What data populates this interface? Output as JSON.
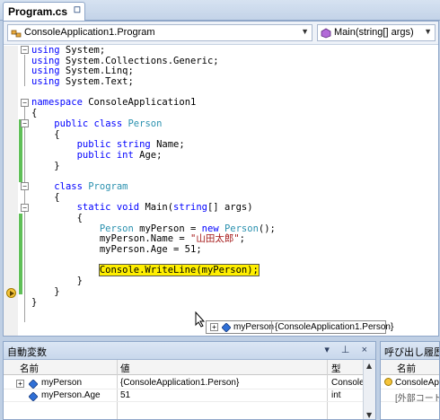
{
  "document_tab": {
    "title": "Program.cs",
    "pin_glyph": "☐"
  },
  "navigation": {
    "type_selector": {
      "value": "ConsoleApplication1.Program",
      "icon": "class-icon"
    },
    "member_selector": {
      "value": "Main(string[] args)",
      "icon": "method-icon"
    }
  },
  "code_lines": [
    [
      [
        "kw",
        "using"
      ],
      [
        "",
        "System;"
      ]
    ],
    [
      [
        "kw",
        "using"
      ],
      [
        "",
        "System.Collections.Generic;"
      ]
    ],
    [
      [
        "kw",
        "using"
      ],
      [
        "",
        "System.Linq;"
      ]
    ],
    [
      [
        "kw",
        "using"
      ],
      [
        "",
        "System.Text;"
      ]
    ],
    [],
    [
      [
        "kw",
        "namespace"
      ],
      [
        "",
        "ConsoleApplication1"
      ]
    ],
    [
      [
        "",
        "{"
      ]
    ],
    [
      [
        "",
        "    "
      ],
      [
        "kw",
        "public class "
      ],
      [
        "ty",
        "Person"
      ]
    ],
    [
      [
        "",
        "    {"
      ]
    ],
    [
      [
        "",
        "        "
      ],
      [
        "kw",
        "public string "
      ],
      [
        "",
        "Name;"
      ]
    ],
    [
      [
        "",
        "        "
      ],
      [
        "kw",
        "public int "
      ],
      [
        "",
        "Age;"
      ]
    ],
    [
      [
        "",
        "    }"
      ]
    ],
    [],
    [
      [
        "",
        "    "
      ],
      [
        "kw",
        "class "
      ],
      [
        "ty",
        "Program"
      ]
    ],
    [
      [
        "",
        "    {"
      ]
    ],
    [
      [
        "",
        "        "
      ],
      [
        "kw",
        "static void "
      ],
      [
        "",
        "Main("
      ],
      [
        "kw",
        "string"
      ],
      [
        "",
        "[] args)"
      ]
    ],
    [
      [
        "",
        "        {"
      ]
    ],
    [
      [
        "",
        "            "
      ],
      [
        "ty",
        "Person "
      ],
      [
        "",
        "myPerson = "
      ],
      [
        "kw",
        "new "
      ],
      [
        "ty",
        "Person"
      ],
      [
        "",
        "();"
      ]
    ],
    [
      [
        "",
        "            myPerson.Name = "
      ],
      [
        "str",
        "\"山田太郎\""
      ],
      [
        "",
        ";"
      ]
    ],
    [
      [
        "",
        "            myPerson.Age = 51;"
      ]
    ],
    [],
    [
      [
        "",
        "            "
      ],
      [
        "hl",
        "Console.WriteLine(myPerson);"
      ]
    ],
    [
      [
        "",
        "        }"
      ]
    ],
    [
      [
        "",
        "    }"
      ]
    ],
    [
      [
        "",
        "}"
      ]
    ]
  ],
  "datatip": {
    "name": "myPerson",
    "value": "{ConsoleApplication1.Person}",
    "expand_glyph": "+"
  },
  "autos_window": {
    "title": "自動変数",
    "title_buttons": "▾ ⊥ ×",
    "columns": {
      "name": "名前",
      "value": "値",
      "type": "型"
    },
    "rows": [
      {
        "expand": "+",
        "name": "myPerson",
        "value": "{ConsoleApplication1.Person}",
        "type": "ConsoleA"
      },
      {
        "expand": "",
        "name": "myPerson.Age",
        "value": "51",
        "type": "int"
      }
    ]
  },
  "callstack_window": {
    "title": "呼び出し履歴",
    "columns": {
      "name": "名前"
    },
    "rows": [
      {
        "name": "ConsoleApp"
      },
      {
        "name": "[外部コード]"
      }
    ]
  },
  "colors": {
    "keyword": "#0000ff",
    "type": "#2b91af",
    "string": "#a31515",
    "current_statement": "#ffef00",
    "change_bar": "#5fbf57"
  }
}
